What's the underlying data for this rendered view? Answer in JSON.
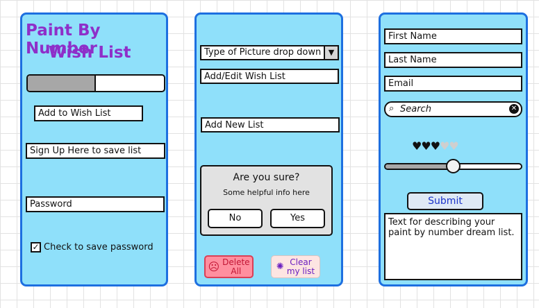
{
  "panel1": {
    "title_line1": "Paint By Number",
    "title_line2": "Wish List",
    "progress": 0.5,
    "add_button": "Add to Wish List",
    "signup_field": "Sign Up Here to save list",
    "password_field": "Password",
    "checkbox_checked": true,
    "checkbox_mark": "✓",
    "checkbox_label": "Check to save password"
  },
  "panel2": {
    "dropdown_value": "Type of Picture drop down",
    "dropdown_arrow": "▼",
    "edit_field": "Add/Edit Wish List",
    "new_list_field": "Add New List",
    "dialog": {
      "title": "Are you sure?",
      "info": "Some helpful info here",
      "no_label": "No",
      "yes_label": "Yes"
    },
    "delete_button": {
      "line1": "Delete",
      "line2": "All",
      "icon": "frown-face-icon"
    },
    "clear_button": {
      "line1": "Clear",
      "line2": "my list",
      "icon": "sparkle-icon"
    }
  },
  "panel3": {
    "first_name": "First Name",
    "last_name": "Last Name",
    "email": "Email",
    "search_placeholder": "Search",
    "search_icon": "search-icon",
    "rating": 3,
    "rating_max": 5,
    "slider_value": 0.5,
    "submit_label": "Submit",
    "description": "Text for describing your paint by number dream list."
  },
  "colors": {
    "panel_bg": "#8fe0fa",
    "panel_border": "#1d6fe0",
    "title": "#8e2fc9",
    "submit_text": "#1a32c9",
    "delete_bg": "#ff8f9f"
  }
}
